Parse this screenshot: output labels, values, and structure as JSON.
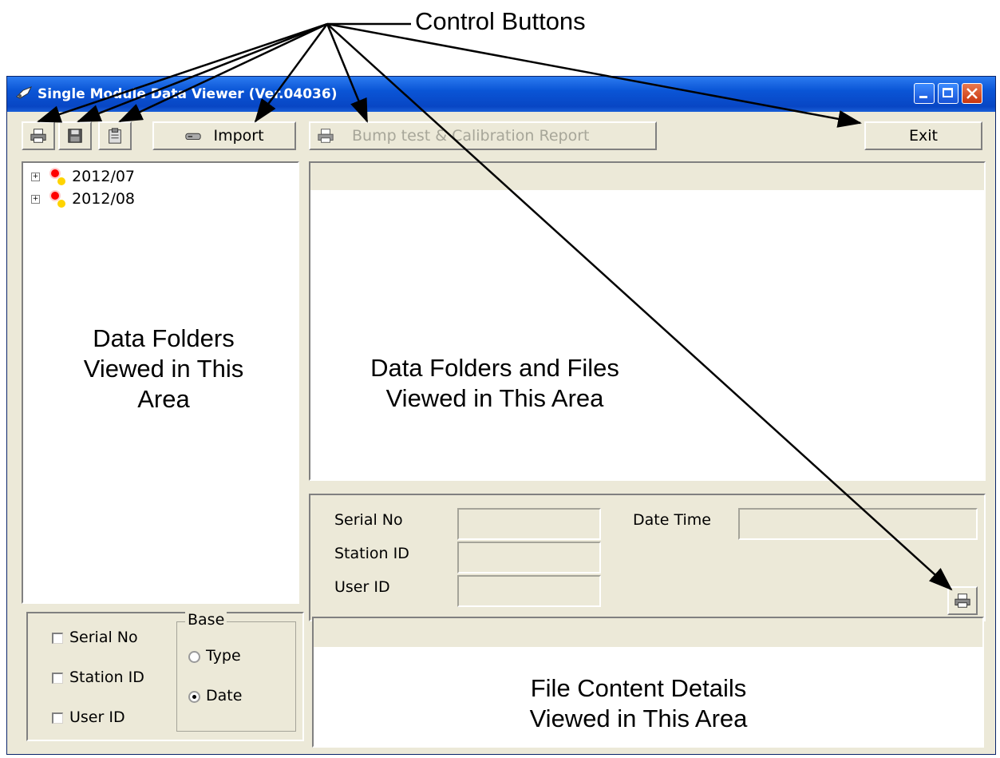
{
  "annotations": {
    "control_buttons": "Control Buttons",
    "folders_area": [
      "Data Folders",
      "Viewed in This",
      "Area"
    ],
    "files_area": [
      "Data Folders and Files",
      "Viewed in This Area"
    ],
    "content_area": [
      "File Content Details",
      "Viewed in This Area"
    ]
  },
  "window": {
    "title": "Single Module Data Viewer (Ver.04036)"
  },
  "toolbar": {
    "print_icon": "printer-icon",
    "save_icon": "floppy-disk-icon",
    "clipboard_icon": "clipboard-icon",
    "import_label": "Import",
    "report_label": "Bump test & Calibration Report",
    "exit_label": "Exit"
  },
  "tree": {
    "items": [
      {
        "label": "2012/07"
      },
      {
        "label": "2012/08"
      }
    ]
  },
  "filters": {
    "checkboxes": [
      {
        "label": "Serial No",
        "checked": false
      },
      {
        "label": "Station ID",
        "checked": false
      },
      {
        "label": "User ID",
        "checked": false
      }
    ],
    "base_group": {
      "title": "Base",
      "options": [
        {
          "label": "Type",
          "selected": false
        },
        {
          "label": "Date",
          "selected": true
        }
      ]
    }
  },
  "details": {
    "serial_label": "Serial No",
    "serial_value": "",
    "date_time_label": "Date Time",
    "date_time_value": "",
    "station_label": "Station ID",
    "station_value": "",
    "user_label": "User ID",
    "user_value": ""
  },
  "colors": {
    "titlebar": "#0a55d6",
    "face": "#ece9d8",
    "disabled_text": "#a7a699"
  }
}
